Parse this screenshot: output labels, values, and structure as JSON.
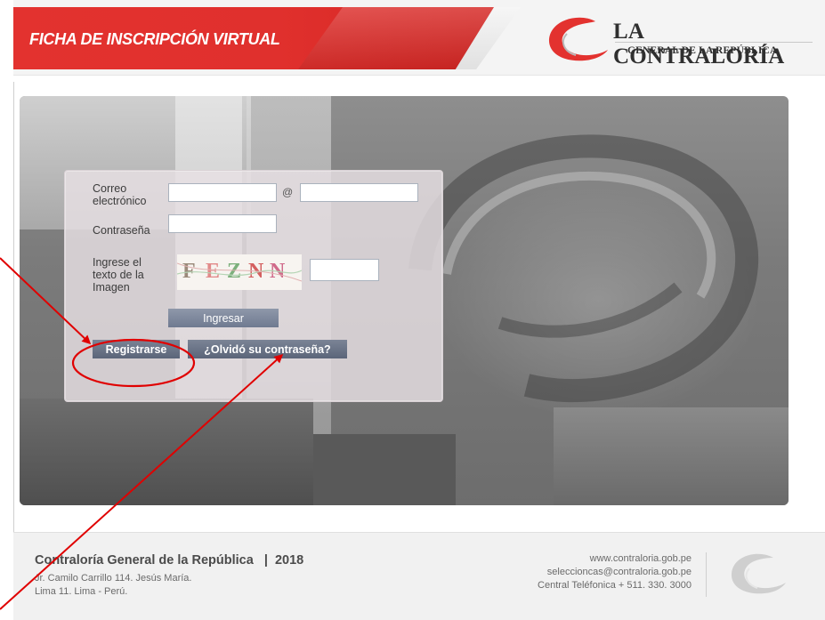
{
  "header": {
    "title": "FICHA DE INSCRIPCIÓN VIRTUAL",
    "logo_line1": "LA CONTRALORÍA",
    "logo_line2": "GENERAL DE LA REPÚBLICA",
    "colors": {
      "brand_red": "#e3322f",
      "logo_text": "#2f2f2f"
    }
  },
  "login": {
    "email_label_1": "Correo",
    "email_label_2": "electrónico",
    "at_symbol": "@",
    "email_user_value": "",
    "email_domain_value": "",
    "password_label": "Contraseña",
    "password_value": "",
    "captcha_label_1": "Ingrese el",
    "captcha_label_2": "texto de la",
    "captcha_label_3": "Imagen",
    "captcha_text": "FEZNN",
    "captcha_value": "",
    "submit_button": "Ingresar",
    "register_button": "Registrarse",
    "forgot_button": "¿Olvidó su contraseña?"
  },
  "footer": {
    "org": "Contraloría General de la República",
    "year_sep": "|",
    "year": "2018",
    "address1": "Jr. Camilo Carrillo 114.  Jesús María.",
    "address2": "Lima 11.  Lima - Perú.",
    "website": "www.contraloria.gob.pe",
    "email": "seleccioncas@contraloria.gob.pe",
    "phone": "Central Teléfonica + 511. 330. 3000"
  },
  "annotations": {
    "color": "#e00000",
    "icons": [
      "arrow-annotation-icon",
      "circle-annotation-icon"
    ]
  }
}
